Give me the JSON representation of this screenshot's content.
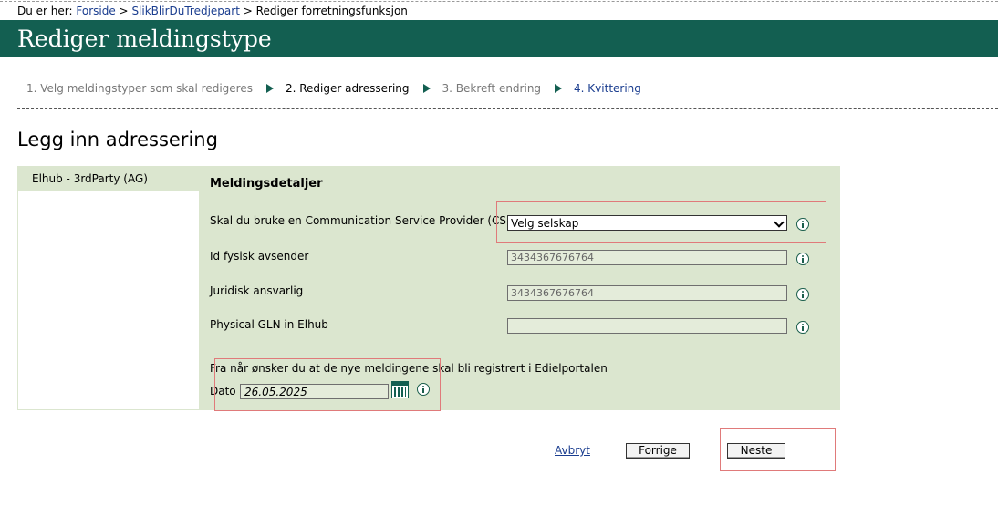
{
  "breadcrumb": {
    "prefix": "Du er her:",
    "items": [
      "Forside",
      "SlikBlirDuTredjepart"
    ],
    "separator": ">",
    "current": "Rediger forretningsfunksjon"
  },
  "header": {
    "title": "Rediger meldingstype"
  },
  "steps": [
    {
      "label": "1. Velg meldingstyper som skal redigeres",
      "state": "done"
    },
    {
      "label": "2. Rediger adressering",
      "state": "active"
    },
    {
      "label": "3. Bekreft endring",
      "state": "pending"
    },
    {
      "label": "4. Kvittering",
      "state": "link"
    }
  ],
  "section_title": "Legg inn adressering",
  "left_panel": {
    "tab_label": "Elhub - 3rdParty (AG)"
  },
  "details": {
    "title": "Meldingsdetaljer",
    "csp": {
      "label": "Skal du bruke en Communication Service Provider (CSP)?",
      "selected": "Velg selskap"
    },
    "id_sender": {
      "label": "Id fysisk avsender",
      "value": "3434367676764"
    },
    "legal": {
      "label": "Juridisk ansvarlig",
      "value": "3434367676764"
    },
    "gln": {
      "label": "Physical GLN in Elhub",
      "value": ""
    },
    "date_question": "Fra når ønsker du at de nye meldingene skal bli registrert i Edielportalen",
    "date": {
      "label": "Dato",
      "value": "26.05.2025"
    }
  },
  "buttons": {
    "cancel": "Avbryt",
    "prev": "Forrige",
    "next": "Neste"
  },
  "icons": [
    "info-icon",
    "calendar-icon",
    "chevron-down-icon",
    "step-arrow-icon"
  ],
  "colors": {
    "header": "#135f51",
    "panel": "#dbe6cf",
    "link": "#1a3d8f",
    "highlight": "#e07a7a"
  }
}
